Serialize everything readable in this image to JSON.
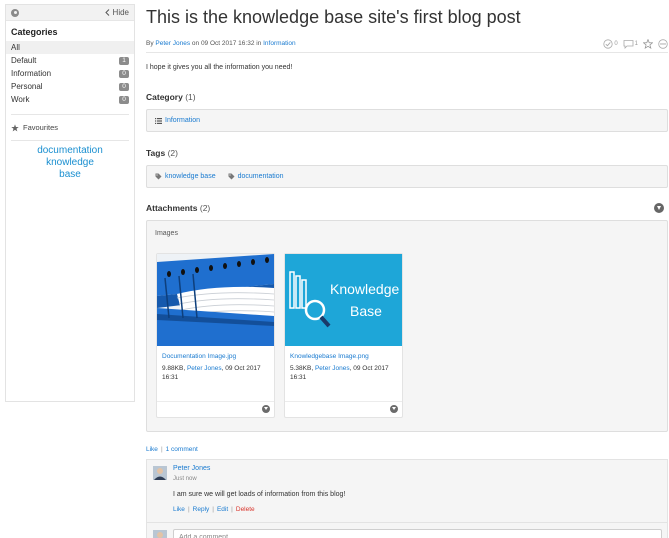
{
  "sidebar": {
    "hide_label": "Hide",
    "categories_title": "Categories",
    "categories": [
      {
        "label": "All",
        "count": ""
      },
      {
        "label": "Default",
        "count": "1"
      },
      {
        "label": "Information",
        "count": "0"
      },
      {
        "label": "Personal",
        "count": "0"
      },
      {
        "label": "Work",
        "count": "0"
      }
    ],
    "favourites_label": "Favourites",
    "tag_cloud": [
      "documentation",
      "knowledge",
      "base"
    ]
  },
  "post": {
    "title": "This is the knowledge base site's first blog post",
    "by_prefix": "By",
    "author": "Peter Jones",
    "date_text": "on 09 Oct 2017 16:32 in",
    "category_link": "Information",
    "approve_count": "0",
    "comment_count": "1",
    "body": "I hope it gives you all the information you need!"
  },
  "category_section": {
    "heading": "Category",
    "count": "(1)",
    "items": [
      "Information"
    ]
  },
  "tags_section": {
    "heading": "Tags",
    "count": "(2)",
    "items": [
      "knowledge base",
      "documentation"
    ]
  },
  "attachments": {
    "heading": "Attachments",
    "count": "(2)",
    "images_label": "Images",
    "files": [
      {
        "name": "Documentation Image.jpg",
        "size": "9.88KB,",
        "author": "Peter Jones",
        "date": ", 09 Oct 2017",
        "time": "16:31"
      },
      {
        "name": "Knowledgebase Image.png",
        "size": "5.38KB,",
        "author": "Peter Jones",
        "date": ", 09 Oct 2017",
        "time": "16:31"
      }
    ],
    "kb_image_line1": "Knowledge",
    "kb_image_line2": "Base"
  },
  "likes": {
    "like_label": "Like",
    "comment_count_label": "1 comment"
  },
  "comment": {
    "author": "Peter Jones",
    "time": "Just now",
    "text": "I am sure we will get loads of information from this blog!",
    "actions": {
      "like": "Like",
      "reply": "Reply",
      "edit": "Edit",
      "delete": "Delete"
    }
  },
  "add_comment": {
    "placeholder": "Add a comment..."
  },
  "colors": {
    "link": "#1a7bd0",
    "delete": "#d9342b",
    "kb_tile": "#1ea6d8"
  }
}
